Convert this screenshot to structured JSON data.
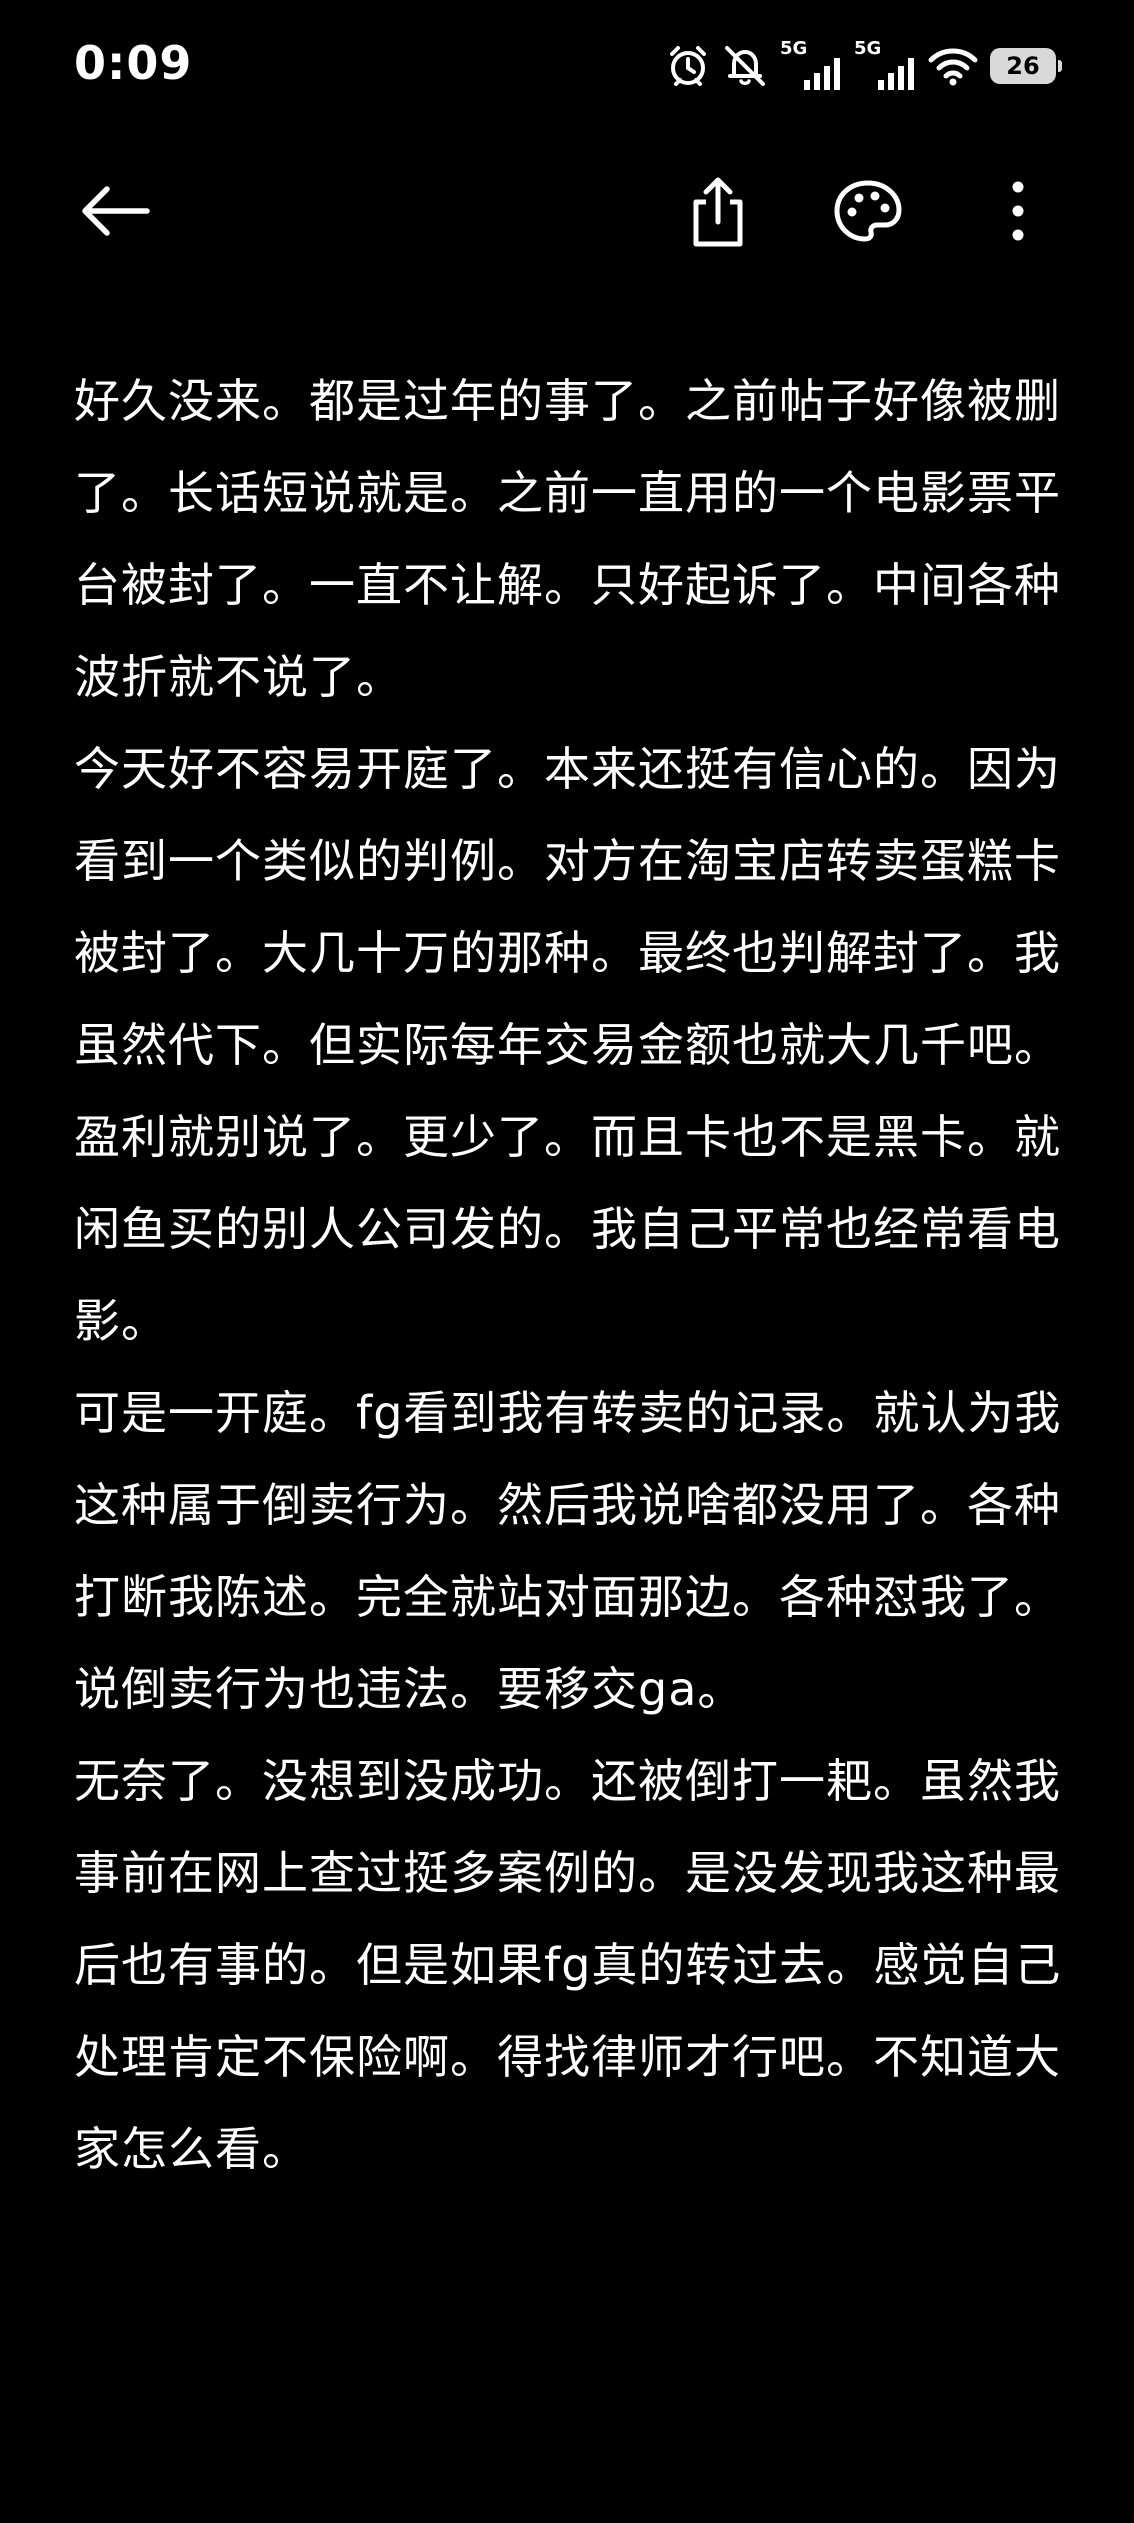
{
  "status_bar": {
    "time": "0:09",
    "network_1": "5G",
    "network_2": "5G",
    "battery": "26",
    "icons": [
      "alarm-icon",
      "mute-icon",
      "signal-icon",
      "signal-icon",
      "wifi-icon",
      "battery-icon"
    ]
  },
  "app_bar": {
    "icons": [
      "back-arrow-icon",
      "share-icon",
      "palette-icon",
      "more-vert-icon"
    ]
  },
  "note": {
    "paragraphs": [
      "好久没来。都是过年的事了。之前帖子好像被删了。长话短说就是。之前一直用的一个电影票平台被封了。一直不让解。只好起诉了。中间各种波折就不说了。",
      "今天好不容易开庭了。本来还挺有信心的。因为看到一个类似的判例。对方在淘宝店转卖蛋糕卡被封了。大几十万的那种。最终也判解封了。我虽然代下。但实际每年交易金额也就大几千吧。盈利就别说了。更少了。而且卡也不是黑卡。就闲鱼买的别人公司发的。我自己平常也经常看电影。",
      "可是一开庭。fg看到我有转卖的记录。就认为我这种属于倒卖行为。然后我说啥都没用了。各种打断我陈述。完全就站对面那边。各种怼我了。说倒卖行为也违法。要移交ga。",
      "无奈了。没想到没成功。还被倒打一耙。虽然我事前在网上查过挺多案例的。是没发现我这种最后也有事的。但是如果fg真的转过去。感觉自己处理肯定不保险啊。得找律师才行吧。不知道大家怎么看。"
    ]
  },
  "colors": {
    "background": "#000000",
    "text": "#ffffff",
    "battery": "#d9d9d9"
  }
}
